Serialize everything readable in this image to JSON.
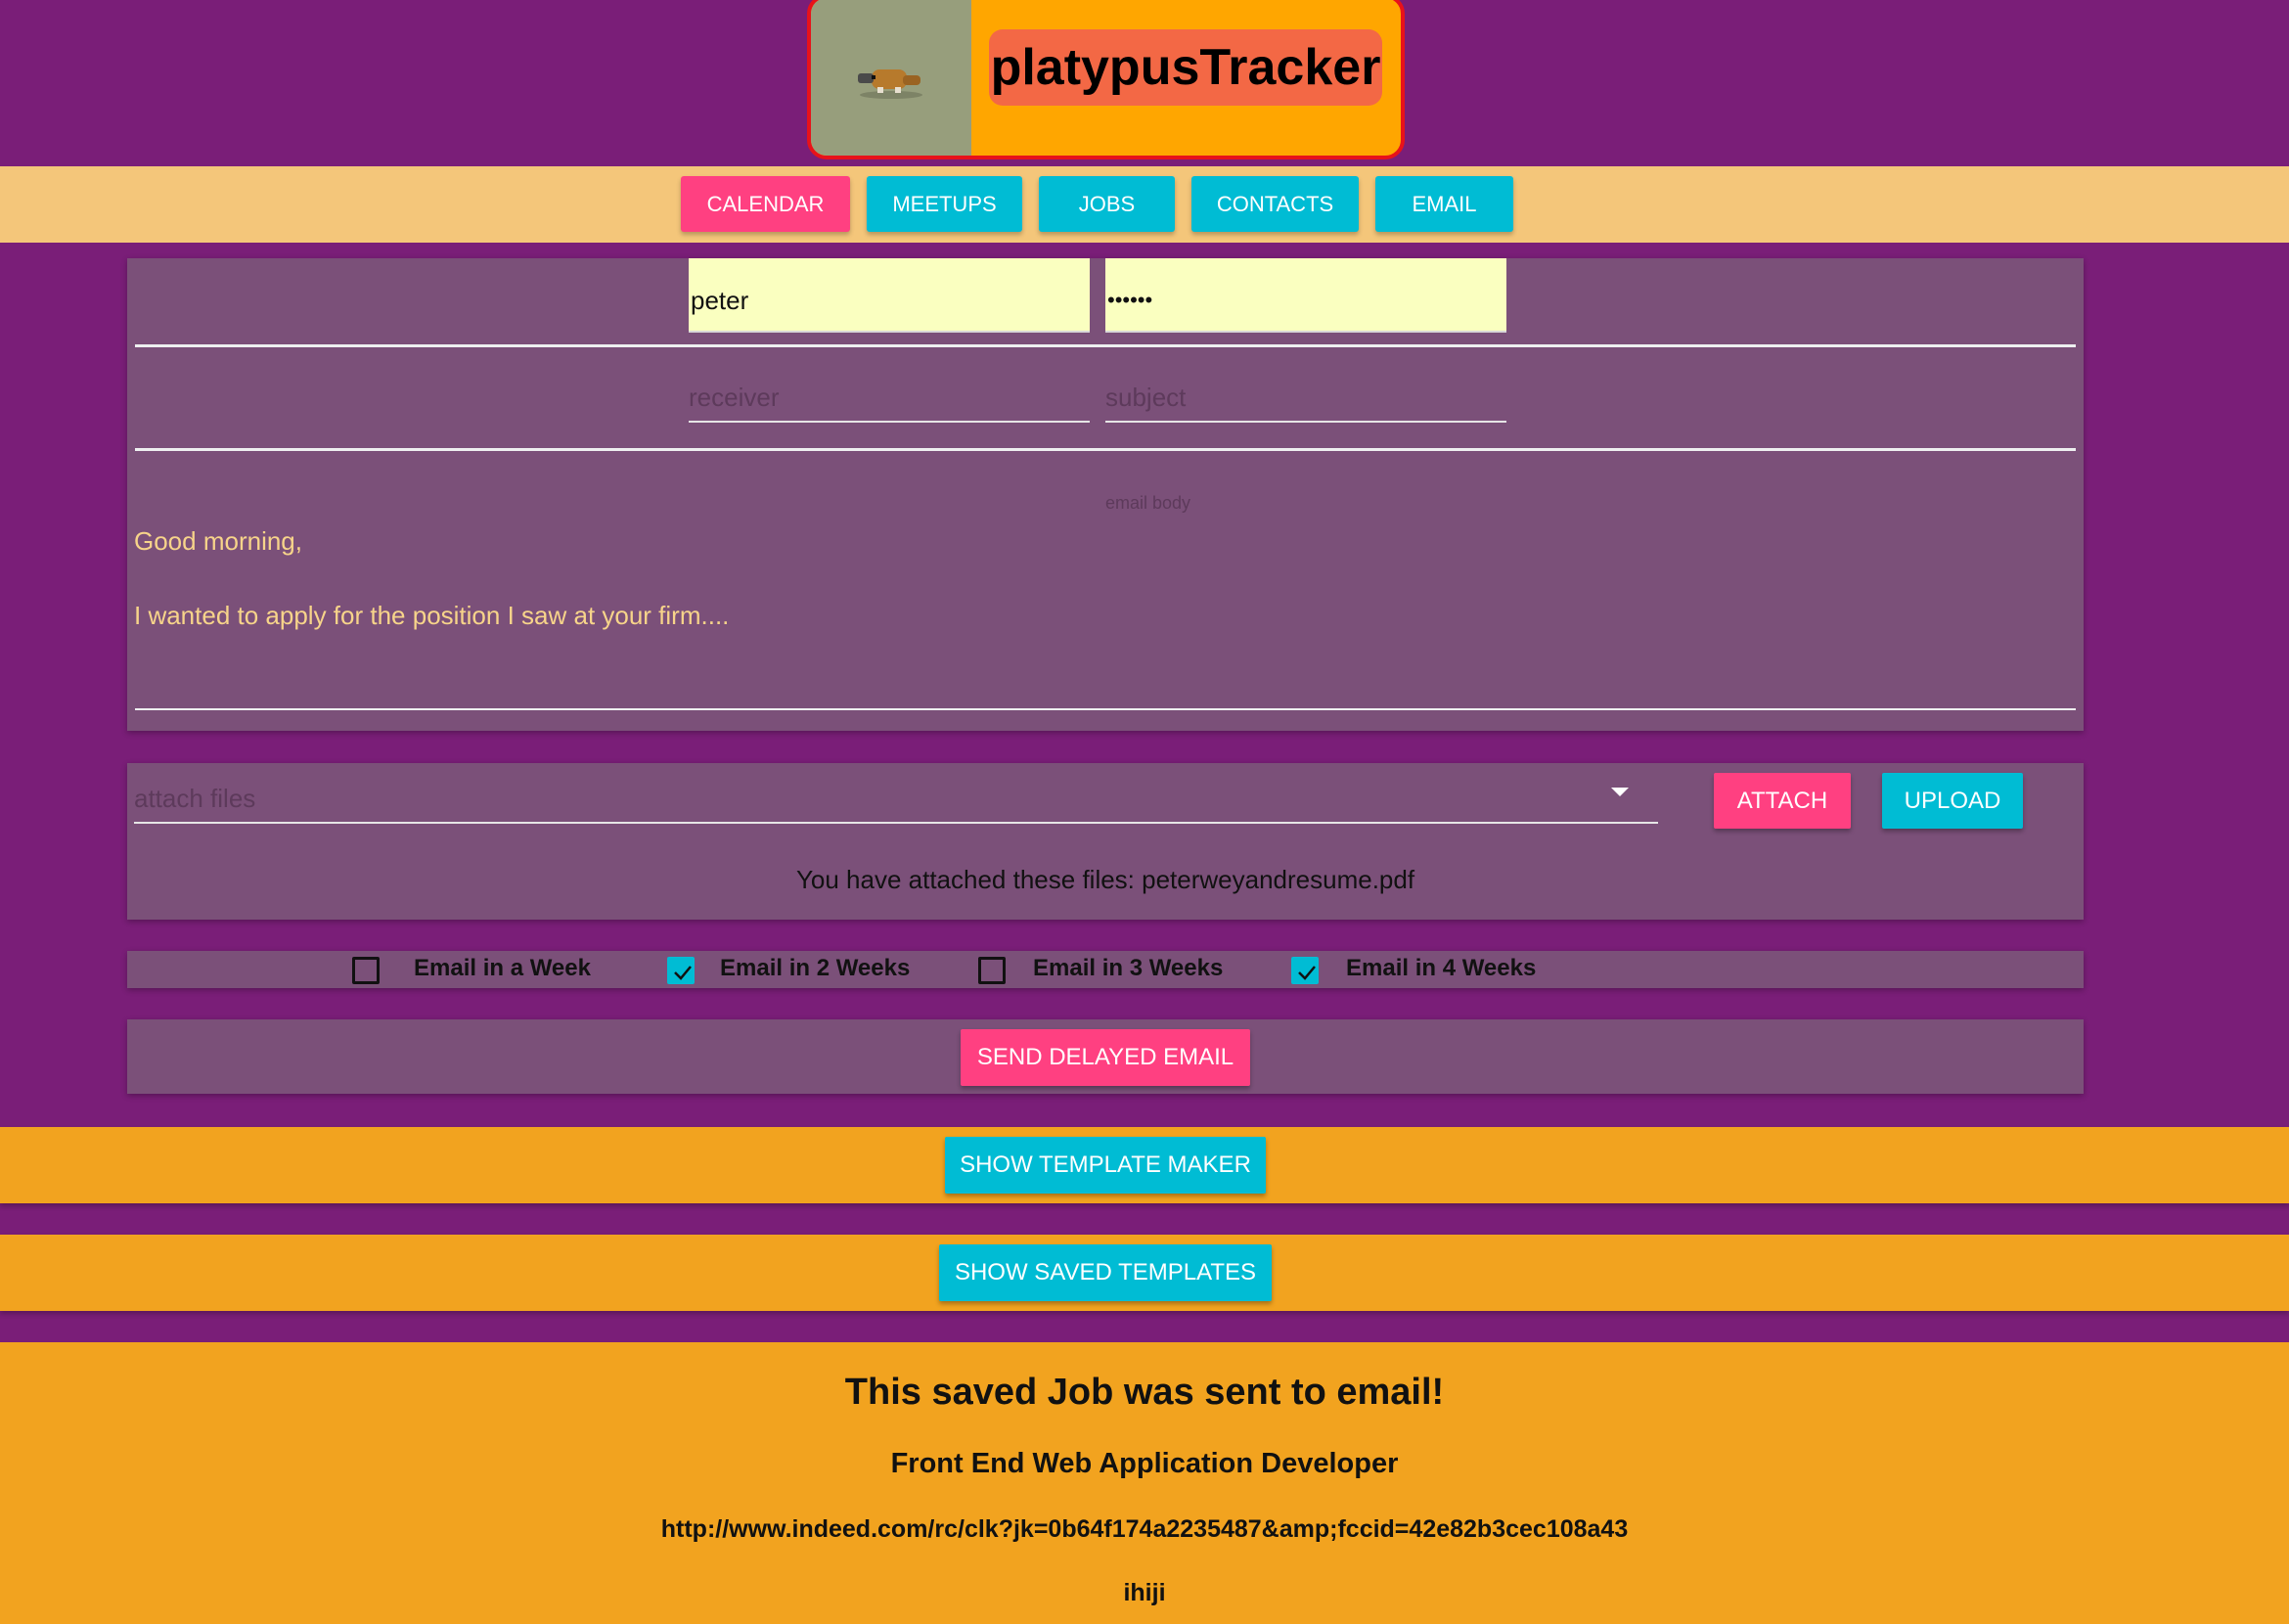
{
  "app": {
    "title": "platypusTracker",
    "logo_icon": "platypus-icon"
  },
  "nav": {
    "items": [
      {
        "label": "CALENDAR",
        "active": true
      },
      {
        "label": "MEETUPS",
        "active": false
      },
      {
        "label": "JOBS",
        "active": false
      },
      {
        "label": "CONTACTS",
        "active": false
      },
      {
        "label": "EMAIL",
        "active": false
      }
    ]
  },
  "credentials": {
    "username_value": "peter",
    "password_value": "••••••"
  },
  "compose": {
    "receiver_placeholder": "receiver",
    "subject_placeholder": "subject",
    "body_label": "email body",
    "body_line1": "Good morning,",
    "body_line2": "I wanted to apply for the position I saw at your firm...."
  },
  "attachments": {
    "select_placeholder": "attach files",
    "attach_label": "ATTACH",
    "upload_label": "UPLOAD",
    "status_text": "You have attached these files: peterweyandresume.pdf"
  },
  "schedule": {
    "options": [
      {
        "label": "Email in a Week",
        "checked": false
      },
      {
        "label": "Email in 2 Weeks",
        "checked": true
      },
      {
        "label": "Email in 3 Weeks",
        "checked": false
      },
      {
        "label": "Email in 4 Weeks",
        "checked": true
      }
    ]
  },
  "actions": {
    "send_label": "SEND DELAYED EMAIL",
    "template_maker_label": "SHOW TEMPLATE MAKER",
    "saved_templates_label": "SHOW SAVED TEMPLATES"
  },
  "saved_job": {
    "heading": "This saved Job was sent to email!",
    "title": "Front End Web Application Developer",
    "url": "http://www.indeed.com/rc/clk?jk=0b64f174a2235487&amp;fccid=42e82b3cec108a43",
    "note": "ihiji"
  },
  "colors": {
    "background": "#7a1e78",
    "accent_pink": "#ff4081",
    "accent_cyan": "#00bcd4",
    "header_orange": "#ffa600",
    "bar_orange": "#f2a31f"
  }
}
